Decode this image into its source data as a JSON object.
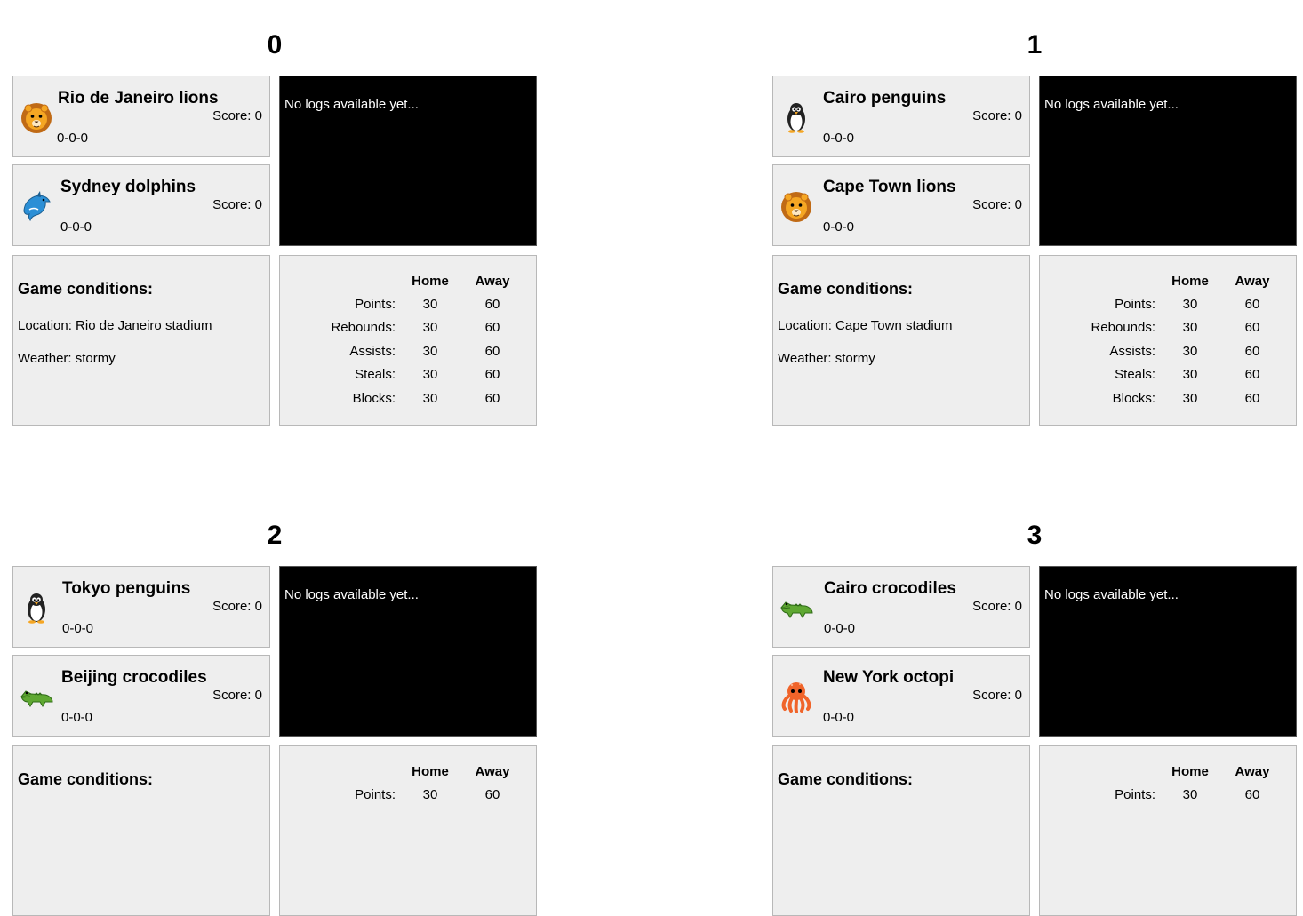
{
  "labels": {
    "score_prefix": "Score: ",
    "logs_empty": "No logs available yet...",
    "conditions_title": "Game conditions:",
    "location_prefix": "Location: ",
    "weather_prefix": "Weather: ",
    "col_home": "Home",
    "col_away": "Away",
    "stat_names": [
      "Points:",
      "Rebounds:",
      "Assists:",
      "Steals:",
      "Blocks:"
    ]
  },
  "games": [
    {
      "number": "0",
      "home": {
        "name": "Rio de Janeiro lions",
        "score": "0",
        "record": "0-0-0",
        "icon": "lion-icon"
      },
      "away": {
        "name": "Sydney dolphins",
        "score": "0",
        "record": "0-0-0",
        "icon": "dolphin-icon"
      },
      "logs": "No logs available yet...",
      "location": "Rio de Janeiro stadium",
      "weather": "stormy",
      "stats": [
        {
          "label": "Points:",
          "home": "30",
          "away": "60"
        },
        {
          "label": "Rebounds:",
          "home": "30",
          "away": "60"
        },
        {
          "label": "Assists:",
          "home": "30",
          "away": "60"
        },
        {
          "label": "Steals:",
          "home": "30",
          "away": "60"
        },
        {
          "label": "Blocks:",
          "home": "30",
          "away": "60"
        }
      ]
    },
    {
      "number": "1",
      "home": {
        "name": "Cairo penguins",
        "score": "0",
        "record": "0-0-0",
        "icon": "penguin-icon"
      },
      "away": {
        "name": "Cape Town lions",
        "score": "0",
        "record": "0-0-0",
        "icon": "lion-icon"
      },
      "logs": "No logs available yet...",
      "location": "Cape Town stadium",
      "weather": "stormy",
      "stats": [
        {
          "label": "Points:",
          "home": "30",
          "away": "60"
        },
        {
          "label": "Rebounds:",
          "home": "30",
          "away": "60"
        },
        {
          "label": "Assists:",
          "home": "30",
          "away": "60"
        },
        {
          "label": "Steals:",
          "home": "30",
          "away": "60"
        },
        {
          "label": "Blocks:",
          "home": "30",
          "away": "60"
        }
      ]
    },
    {
      "number": "2",
      "home": {
        "name": "Tokyo penguins",
        "score": "0",
        "record": "0-0-0",
        "icon": "penguin-icon"
      },
      "away": {
        "name": "Beijing crocodiles",
        "score": "0",
        "record": "0-0-0",
        "icon": "crocodile-icon"
      },
      "logs": "No logs available yet...",
      "location": "",
      "weather": "",
      "stats": [
        {
          "label": "Points:",
          "home": "30",
          "away": "60"
        }
      ]
    },
    {
      "number": "3",
      "home": {
        "name": "Cairo crocodiles",
        "score": "0",
        "record": "0-0-0",
        "icon": "crocodile-icon"
      },
      "away": {
        "name": "New York octopi",
        "score": "0",
        "record": "0-0-0",
        "icon": "octopus-icon"
      },
      "logs": "No logs available yet...",
      "location": "",
      "weather": "",
      "stats": [
        {
          "label": "Points:",
          "home": "30",
          "away": "60"
        }
      ]
    }
  ]
}
